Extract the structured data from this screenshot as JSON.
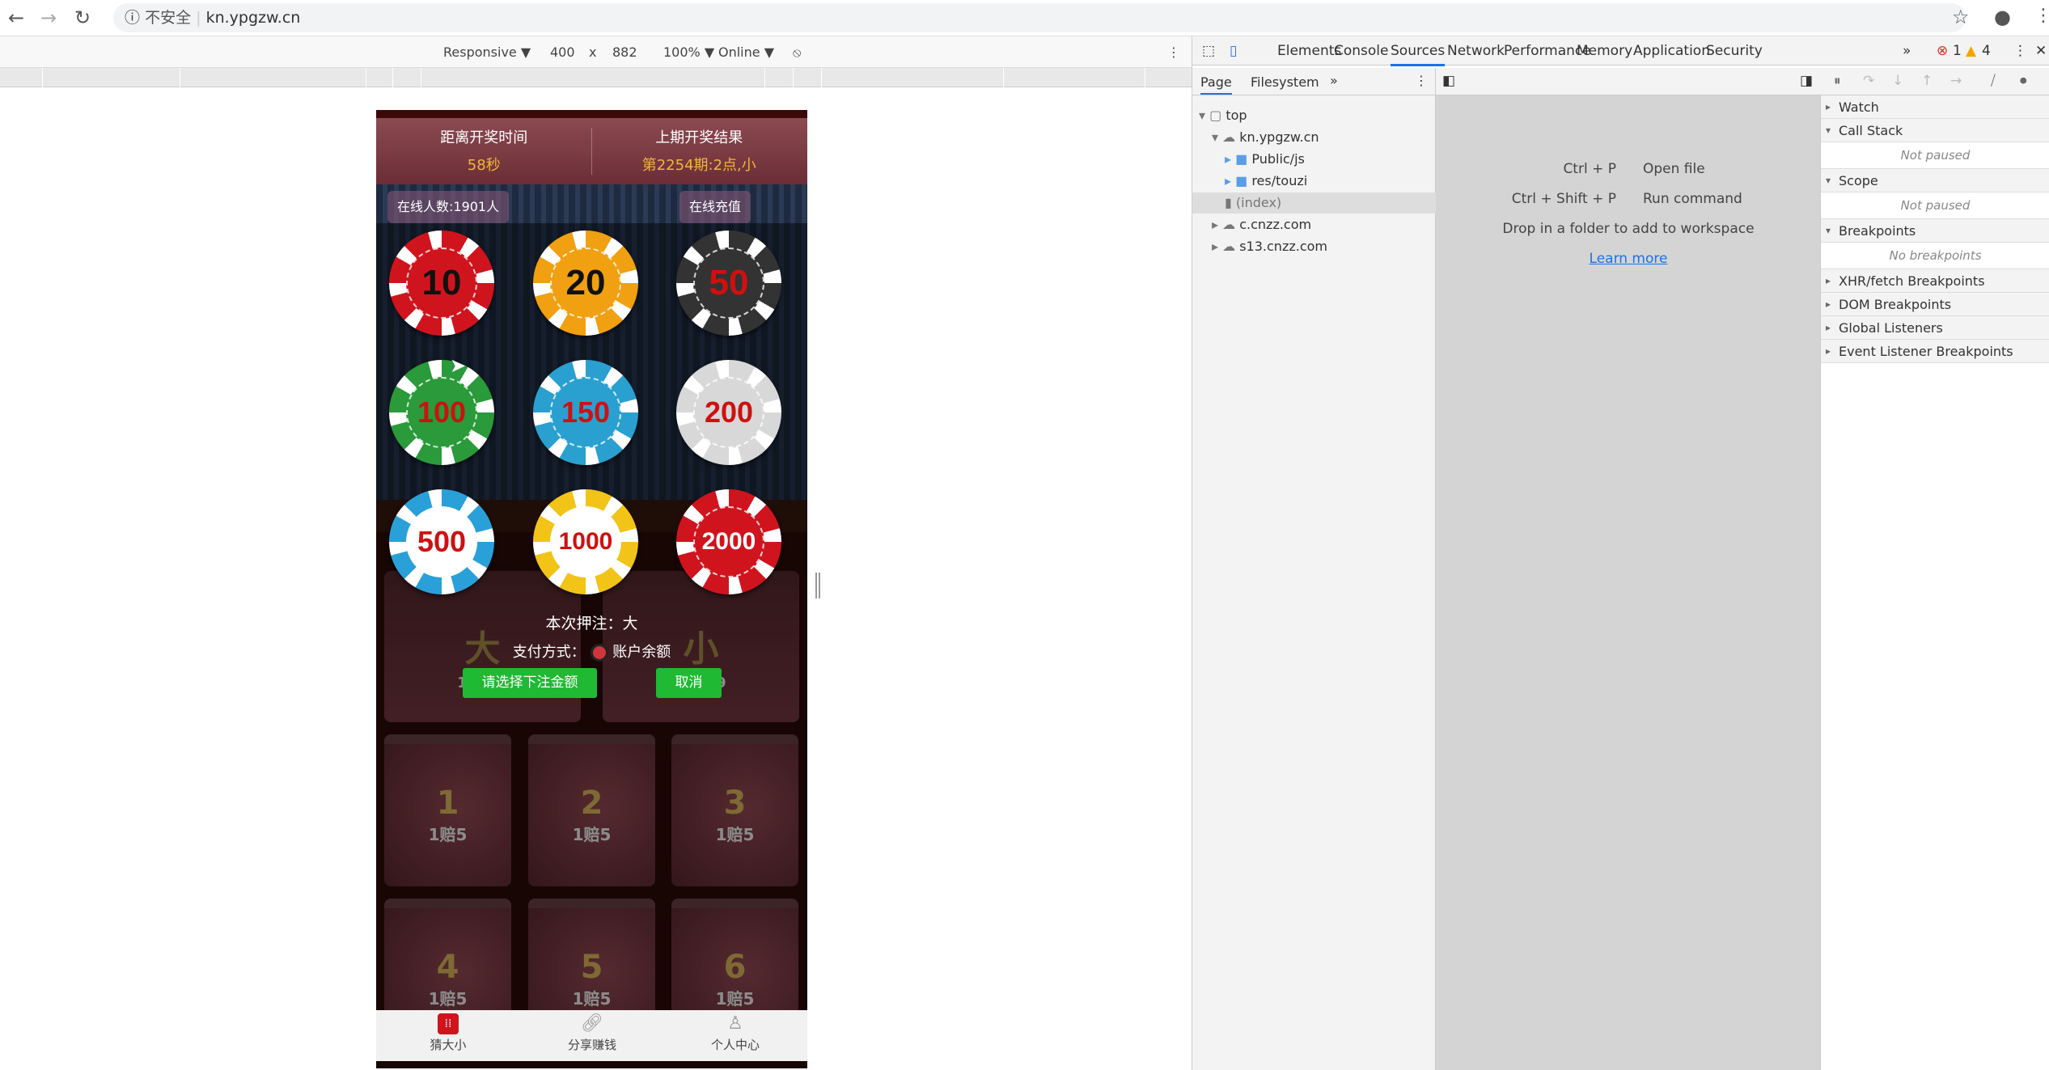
{
  "browser": {
    "security_label": "不安全",
    "url": "kn.ypgzw.cn"
  },
  "device_toolbar": {
    "device": "Responsive ▼",
    "width": "400",
    "x": "x",
    "height": "882",
    "zoom": "100% ▼",
    "network": "Online ▼"
  },
  "game": {
    "header": {
      "countdown_label": "距离开奖时间",
      "countdown_value": "58秒",
      "last_result_label": "上期开奖结果",
      "last_result_value": "第2254期:2点,小"
    },
    "online_count": "在线人数:1901人",
    "recharge": "在线充值",
    "chips": [
      {
        "value": "10",
        "color": "#d0141e",
        "text": "#111"
      },
      {
        "value": "20",
        "color": "#f0a010",
        "text": "#111"
      },
      {
        "value": "50",
        "color": "#333333",
        "text": "#d01010"
      },
      {
        "value": "100",
        "color": "#2a9a3a",
        "text": "#d01010"
      },
      {
        "value": "150",
        "color": "#2aa0d0",
        "text": "#d01010"
      },
      {
        "value": "200",
        "color": "#d8d8d8",
        "text": "#d01010"
      },
      {
        "value": "500",
        "color": "#2aa0d8",
        "text": "#d01010"
      },
      {
        "value": "1000",
        "color": "#f2c418",
        "text": "#d01010"
      },
      {
        "value": "2000",
        "color": "#d0141e",
        "text": "#fff"
      }
    ],
    "big": {
      "label": "大",
      "odds": "1赔1.9"
    },
    "small": {
      "label": "小",
      "odds": "1赔1.9"
    },
    "dialog": {
      "bet_label": "本次押注：大",
      "pay_label": "支付方式：",
      "pay_option": "账户余额",
      "confirm": "请选择下注金额",
      "cancel": "取消"
    },
    "numbers": [
      {
        "n": "1",
        "odds": "1赔5"
      },
      {
        "n": "2",
        "odds": "1赔5"
      },
      {
        "n": "3",
        "odds": "1赔5"
      },
      {
        "n": "4",
        "odds": "1赔5"
      },
      {
        "n": "5",
        "odds": "1赔5"
      },
      {
        "n": "6",
        "odds": "1赔5"
      }
    ],
    "bottom_nav": [
      {
        "label": "猜大小",
        "icon": "dice-icon"
      },
      {
        "label": "分享赚钱",
        "icon": "link-icon"
      },
      {
        "label": "个人中心",
        "icon": "user-icon"
      }
    ]
  },
  "devtools": {
    "tabs": [
      "Elements",
      "Console",
      "Sources",
      "Network",
      "Performance",
      "Memory",
      "Application",
      "Security"
    ],
    "active_tab": "Sources",
    "errors": "1",
    "warnings": "4",
    "navigator_tabs": [
      "Page",
      "Filesystem"
    ],
    "tree": [
      "top",
      "kn.ypgzw.cn",
      "Public/js",
      "res/touzi",
      "(index)",
      "c.cnzz.com",
      "s13.cnzz.com"
    ],
    "shortcuts": [
      {
        "keys": "Ctrl + P",
        "action": "Open file"
      },
      {
        "keys": "Ctrl + Shift + P",
        "action": "Run command"
      }
    ],
    "drop_hint": "Drop in a folder to add to workspace",
    "learn_more": "Learn more",
    "sections": {
      "watch": "Watch",
      "call_stack": "Call Stack",
      "not_paused": "Not paused",
      "scope": "Scope",
      "breakpoints": "Breakpoints",
      "no_breakpoints": "No breakpoints",
      "xhr": "XHR/fetch Breakpoints",
      "dom": "DOM Breakpoints",
      "global": "Global Listeners",
      "event": "Event Listener Breakpoints"
    }
  }
}
